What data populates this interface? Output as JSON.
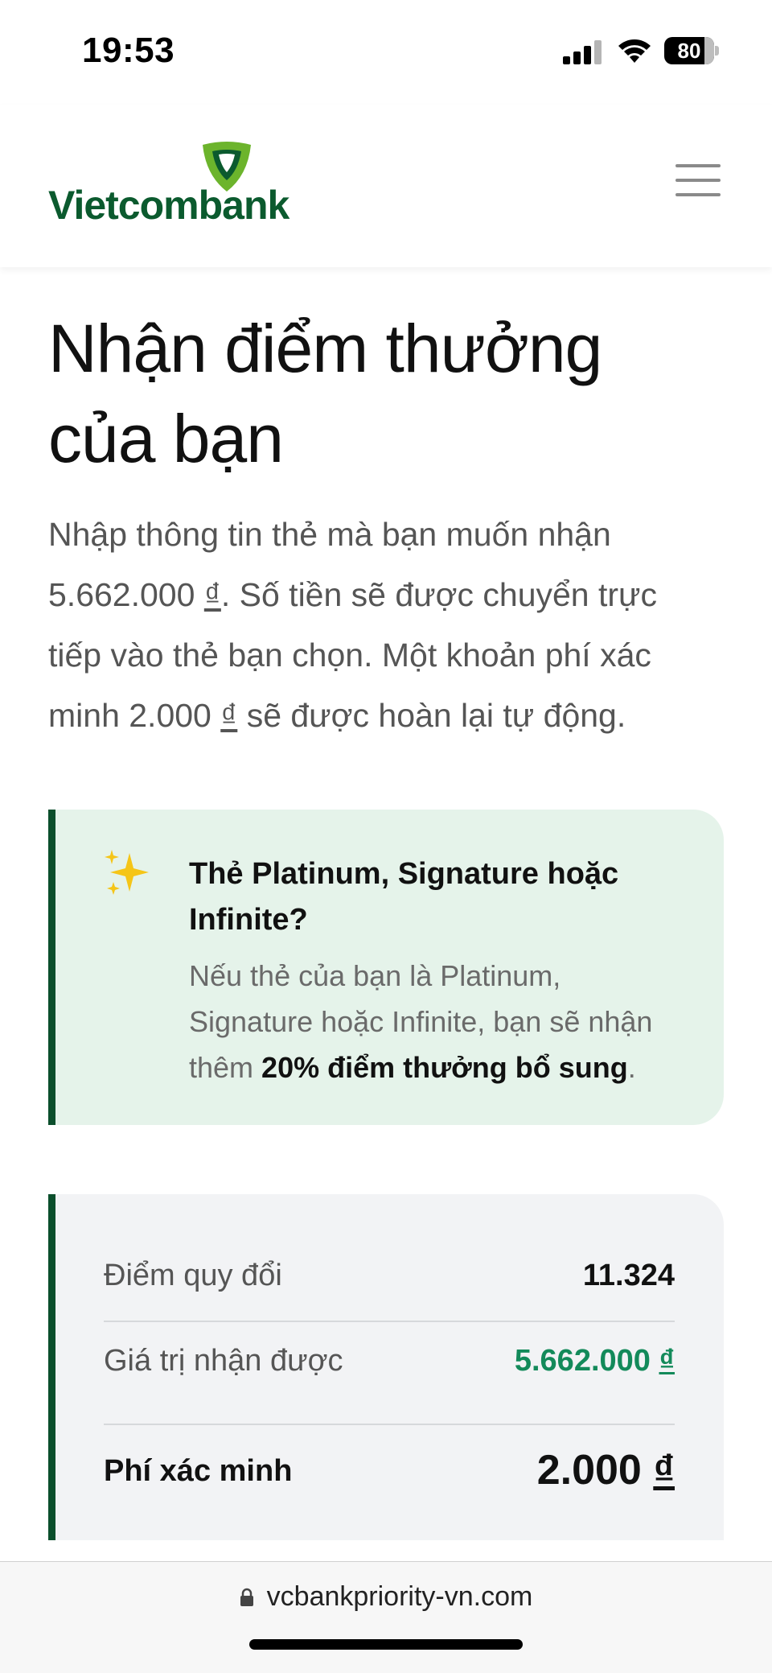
{
  "status_bar": {
    "time": "19:53",
    "battery_level": "80",
    "icons": [
      "signal-icon",
      "wifi-icon",
      "battery-icon"
    ]
  },
  "header": {
    "logo_text": "Vietcombank",
    "menu_icon": "hamburger-menu-icon",
    "brand_color": "#0b5a2e",
    "accent_color": "#6cb42c"
  },
  "main": {
    "title_line1": "Nhận điểm thưởng",
    "title_line2": "của bạn",
    "intro": {
      "line1": "Nhập thông tin thẻ mà bạn muốn nhận",
      "line2_amount": "5.662.000",
      "line2_currency": "₫",
      "line2_rest": ". Số tiền sẽ được chuyển trực",
      "line3": "tiếp vào thẻ bạn chọn. Một khoản phí xác",
      "line4_prefix": "minh 2.000 ",
      "line4_currency": "₫",
      "line4_rest": " sẽ được hoàn lại tự động."
    },
    "callout": {
      "icon": "sparkles-icon",
      "title": "Thẻ Platinum, Signature hoặc Infinite?",
      "body_prefix": "Nếu thẻ của bạn là Platinum, Signature hoặc Infinite, bạn sẽ nhận thêm ",
      "body_bold": "20% điểm thưởng bổ sung",
      "body_suffix": ".",
      "background_color": "#e5f3ea"
    },
    "summary": {
      "rows": [
        {
          "label": "Điểm quy đổi",
          "value": "11.324"
        },
        {
          "label": "Giá trị nhận được",
          "value": "5.662.000",
          "currency": "₫"
        },
        {
          "label": "Phí xác minh",
          "value": "2.000",
          "currency": "₫"
        }
      ],
      "value_accent_color": "#138a5a"
    }
  },
  "browser": {
    "url": "vcbankpriority-vn.com",
    "lock_icon": "lock-icon"
  }
}
